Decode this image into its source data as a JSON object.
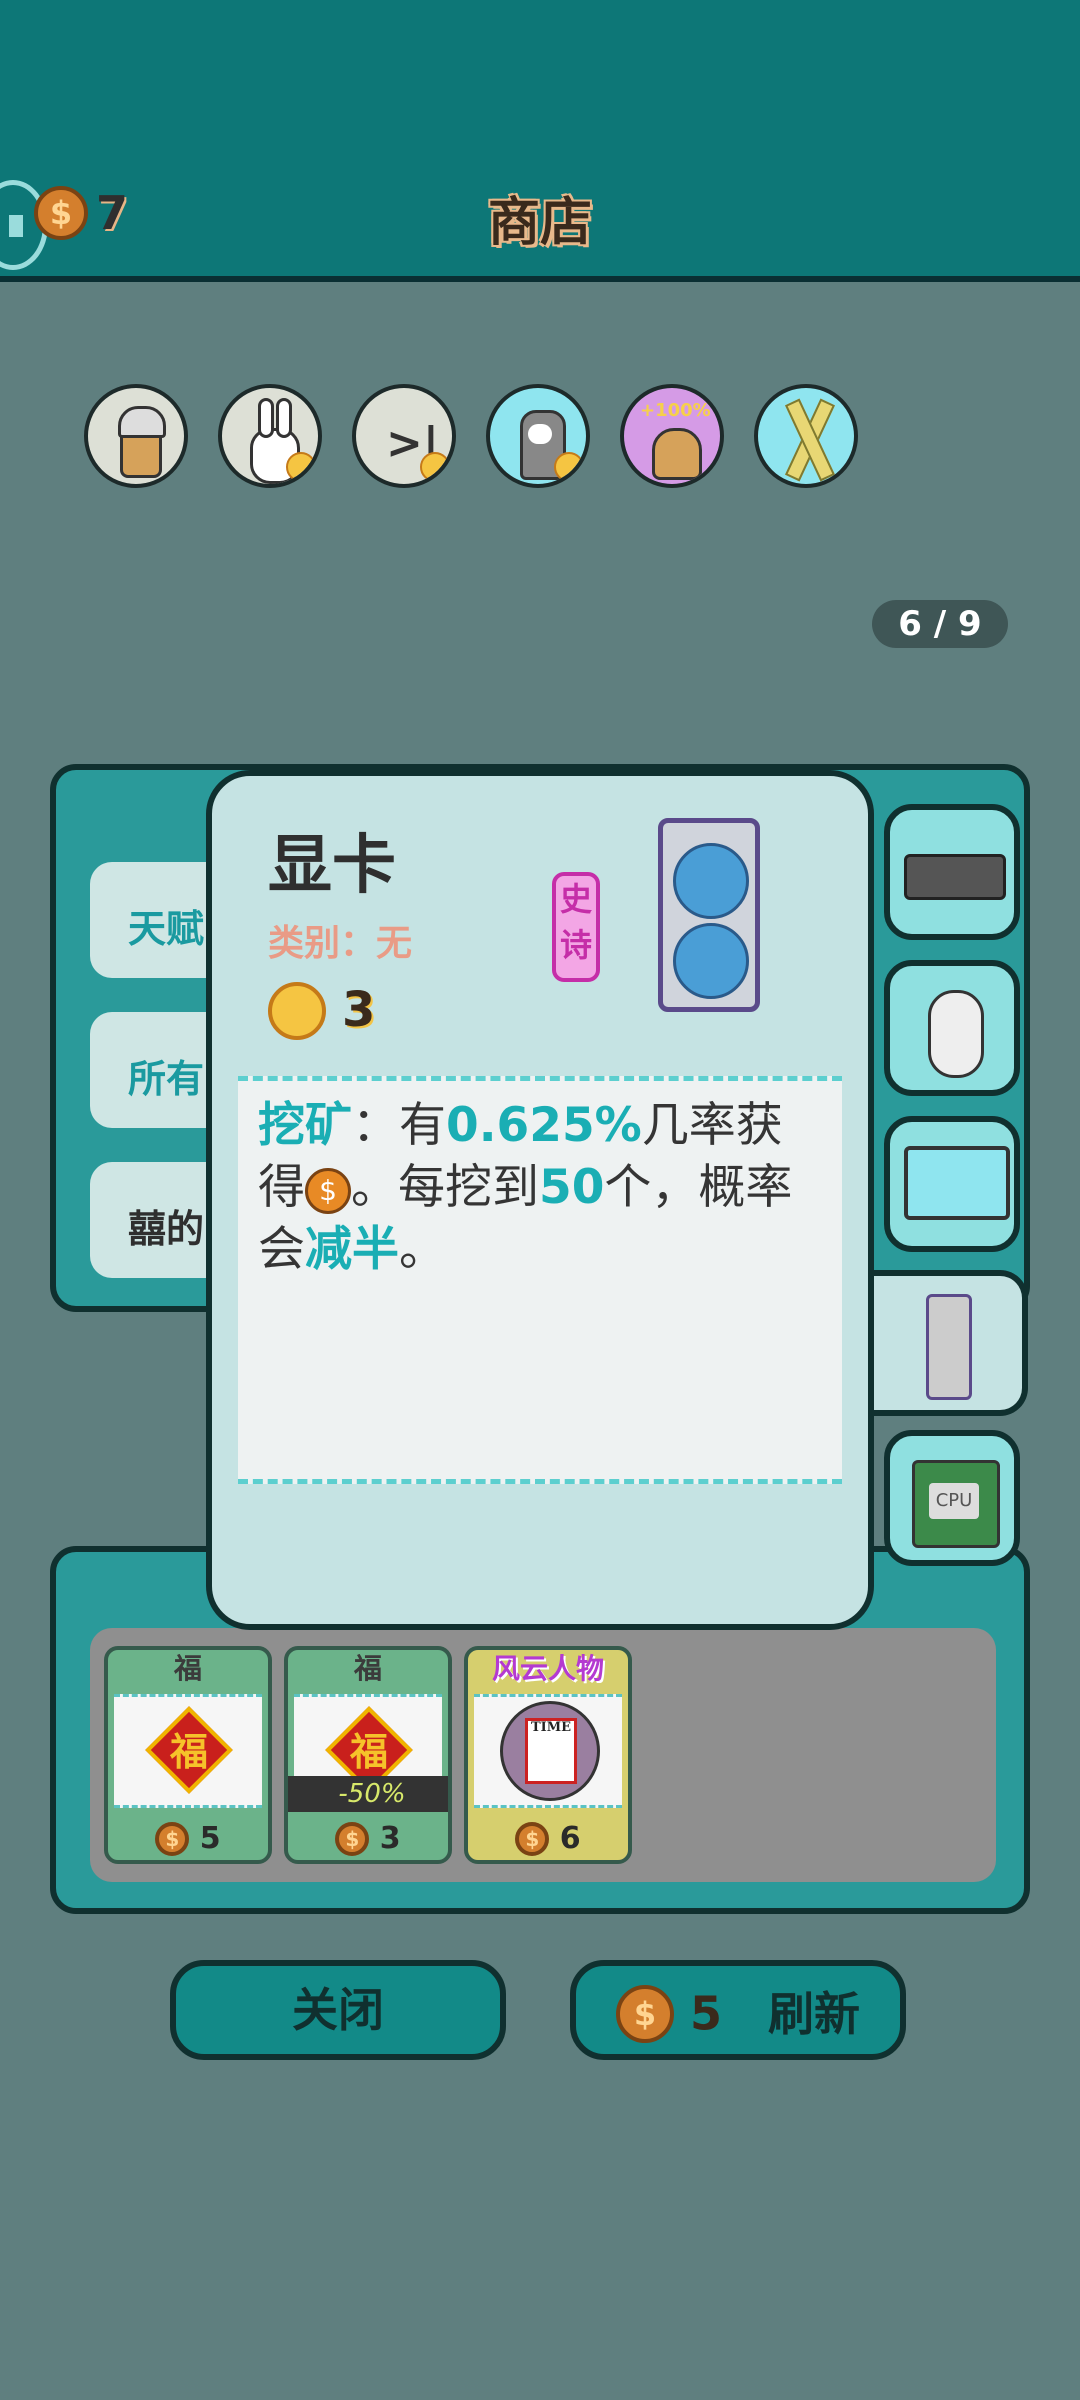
{
  "header": {
    "title": "商店",
    "coin_count": "7"
  },
  "relics": [
    {
      "name": "milk-tea-cup-icon",
      "bg": "#dde0d6"
    },
    {
      "name": "white-rabbit-icon",
      "bg": "#dde0d6"
    },
    {
      "name": "skip-icon",
      "bg": "#dde0d6"
    },
    {
      "name": "husky-dog-icon",
      "bg": "#8fe5ef"
    },
    {
      "name": "bubble-tea-plus-icon",
      "bg": "#d59be6",
      "badge": "+100%"
    },
    {
      "name": "crossed-straws-icon",
      "bg": "#8fe5ef"
    }
  ],
  "pager": "6 / 9",
  "background_list": {
    "rows": [
      "天赋",
      "所有",
      "囍的"
    ]
  },
  "card": {
    "name": "显卡",
    "category": "类别：无",
    "rarity": "史诗",
    "level": "3",
    "desc_keyword": "挖矿",
    "desc_sep": "：有",
    "desc_chance": "0.625%",
    "desc_t1": "几率获得",
    "desc_t2": "。每挖到",
    "desc_count": "50",
    "desc_t3": "个，概率会",
    "desc_halve": "减半",
    "desc_end": "。"
  },
  "tabs": [
    "keyboard-icon",
    "mouse-icon",
    "monitor-icon",
    "graphics-card-icon",
    "cpu-icon"
  ],
  "cpu_label": "CPU",
  "shop_items": [
    {
      "title": "福",
      "price": "5",
      "discount": ""
    },
    {
      "title": "福",
      "price": "3",
      "discount": "-50%"
    },
    {
      "title": "风云人物",
      "price": "6",
      "discount": "",
      "cover_text": "TIME"
    }
  ],
  "buttons": {
    "close": "关闭",
    "refresh": "刷新",
    "refresh_cost": "5"
  },
  "colors": {
    "header": "#0d7777",
    "panel": "#2a9a9a",
    "highlight": "#1aaeb4",
    "epic": "#c52ea8"
  }
}
